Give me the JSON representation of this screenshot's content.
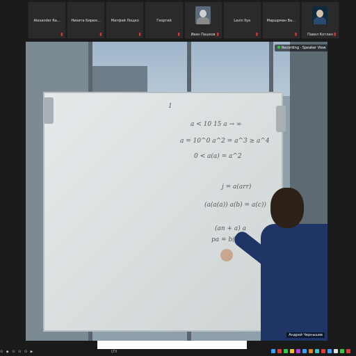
{
  "participants": [
    {
      "name": "Alexander Ra...",
      "mic": "muted"
    },
    {
      "name": "Никита Бирюк...",
      "mic": "muted"
    },
    {
      "name": "Матфей Лощко",
      "mic": "muted"
    },
    {
      "name": "Георгий",
      "mic": "muted"
    },
    {
      "name": "Иван Пашков",
      "mic": "muted",
      "has_avatar": true
    },
    {
      "name": "Lavin Ilya",
      "mic": "muted"
    },
    {
      "name": "Маршрман Ва...",
      "mic": "muted"
    },
    {
      "name": "Павел Котлин",
      "mic": "muted",
      "has_avatar": true
    }
  ],
  "video": {
    "label": "Recording · Speaker View",
    "speaker_name": "Андрей Чернышев"
  },
  "board": {
    "lines": [
      "а < 10 15 а → ∞ ",
      "а = 10^0 а^2 = а^3 ≥ а^4",
      "0 < а(а) = а^2",
      "j = a(arr)",
      "(a(a(a)) a(b) = a(c))",
      "(an + a) a",
      "pa = b(a(a))"
    ],
    "page_marker": "1"
  },
  "taskbar": {
    "left_items": [
      "⊙",
      "◆",
      "⊙",
      "⊙",
      "⊙",
      "▶"
    ],
    "mid_text": "LTX"
  },
  "colors": {
    "mic_muted": "#e03a3a",
    "recording_dot": "#2ecc40",
    "background": "#1b1b1b"
  }
}
